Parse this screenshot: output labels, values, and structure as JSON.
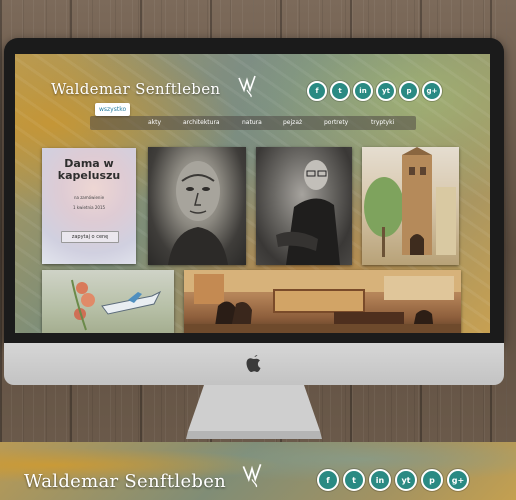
{
  "site": {
    "brand": "Waldemar Senftleben",
    "accent": "#2a8a83",
    "nav_active_color": "#2a7fa0"
  },
  "social": [
    {
      "label": "f",
      "icon": "facebook-icon"
    },
    {
      "label": "t",
      "icon": "twitter-icon"
    },
    {
      "label": "in",
      "icon": "linkedin-icon"
    },
    {
      "label": "yt",
      "icon": "youtube-icon"
    },
    {
      "label": "p",
      "icon": "pinterest-icon"
    },
    {
      "label": "g+",
      "icon": "google-plus-icon"
    }
  ],
  "nav": {
    "active": "wszystko",
    "items": [
      "akty",
      "architektura",
      "natura",
      "pejzaż",
      "portrety",
      "tryptyki"
    ]
  },
  "featured": {
    "title": "Dama w\nkapeluszu",
    "subtitle": "na zamówienie",
    "date": "1 kwietnia 2015",
    "button": "zapytaj o cenę"
  }
}
